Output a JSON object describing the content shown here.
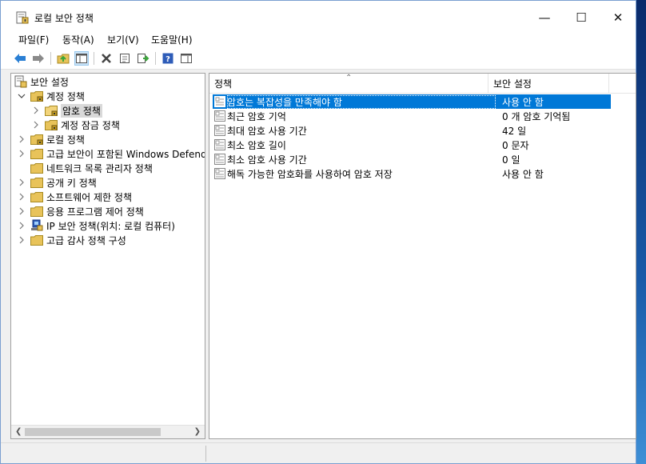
{
  "window": {
    "title": "로컬 보안 정책",
    "minimize_glyph": "—",
    "maximize_glyph": "☐",
    "close_glyph": "✕"
  },
  "menu": [
    "파일(F)",
    "동작(A)",
    "보기(V)",
    "도움말(H)"
  ],
  "toolbar": [
    "back-icon",
    "forward-icon",
    "up-folder-icon",
    "show-hide-tree-icon",
    "delete-icon",
    "properties-icon",
    "export-list-icon",
    "help-icon",
    "show-action-pane-icon"
  ],
  "tree": {
    "root": "보안 설정",
    "items": [
      {
        "label": "계정 정책",
        "level": 1,
        "expanded": true,
        "icon": "policy-folder"
      },
      {
        "label": "암호 정책",
        "level": 2,
        "selected": true,
        "icon": "policy-folder-open"
      },
      {
        "label": "계정 잠금 정책",
        "level": 2,
        "icon": "policy-folder"
      },
      {
        "label": "로컬 정책",
        "level": 1,
        "icon": "policy-folder"
      },
      {
        "label": "고급 보안이 포함된 Windows Defende",
        "level": 1,
        "icon": "folder"
      },
      {
        "label": "네트워크 목록 관리자 정책",
        "level": 1,
        "icon": "folder",
        "nochev": true
      },
      {
        "label": "공개 키 정책",
        "level": 1,
        "icon": "folder"
      },
      {
        "label": "소프트웨어 제한 정책",
        "level": 1,
        "icon": "folder"
      },
      {
        "label": "응용 프로그램 제어 정책",
        "level": 1,
        "icon": "folder"
      },
      {
        "label": "IP 보안 정책(위치: 로컬 컴퓨터)",
        "level": 1,
        "icon": "ipsec"
      },
      {
        "label": "고급 감사 정책 구성",
        "level": 1,
        "icon": "folder"
      }
    ]
  },
  "columns": {
    "policy": "정책",
    "setting": "보안 설정"
  },
  "policies": [
    {
      "name": "암호는 복잡성을 만족해야 함",
      "value": "사용 안 함",
      "selected": true
    },
    {
      "name": "최근 암호 기억",
      "value": "0 개 암호 기억됨"
    },
    {
      "name": "최대 암호 사용 기간",
      "value": "42 일"
    },
    {
      "name": "최소 암호 길이",
      "value": "0 문자"
    },
    {
      "name": "최소 암호 사용 기간",
      "value": "0 일"
    },
    {
      "name": "해독 가능한 암호화를 사용하여 암호 저장",
      "value": "사용 안 함"
    }
  ],
  "colors": {
    "selection": "#0078d7",
    "folder": "#e8c35a",
    "accent_green": "#3aa53a",
    "back_arrow": "#2a7fd4"
  }
}
